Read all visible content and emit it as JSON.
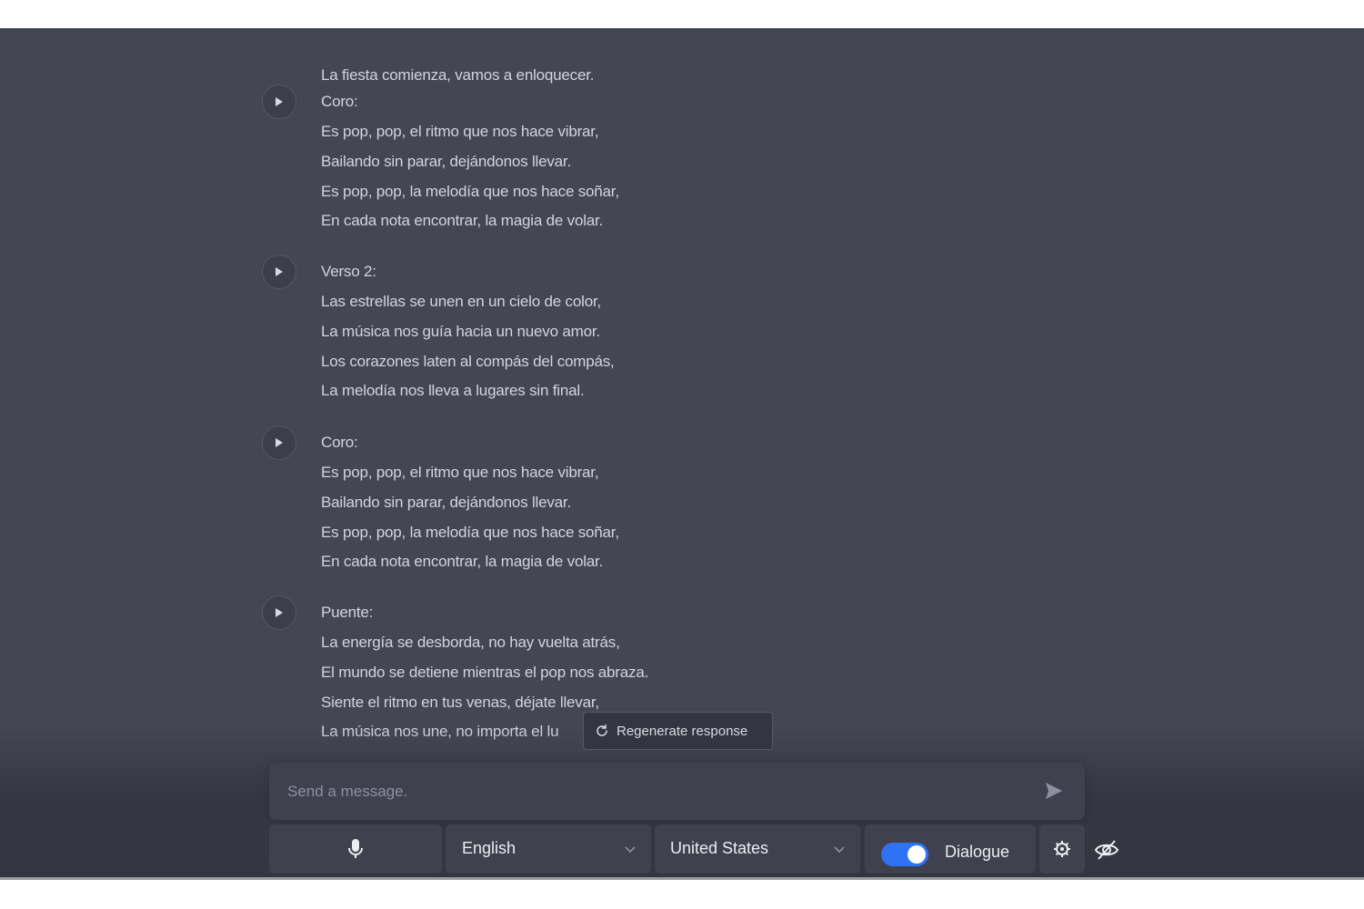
{
  "conversation": {
    "intro_line": "La fiesta comienza, vamos a enloquecer.",
    "stanzas": [
      {
        "heading": "Coro:",
        "lines": [
          "Es pop, pop, el ritmo que nos hace vibrar,",
          "Bailando sin parar, dejándonos llevar.",
          "Es pop, pop, la melodía que nos hace soñar,",
          "En cada nota encontrar, la magia de volar."
        ]
      },
      {
        "heading": "Verso 2:",
        "lines": [
          "Las estrellas se unen en un cielo de color,",
          "La música nos guía hacia un nuevo amor.",
          "Los corazones laten al compás del compás,",
          "La melodía nos lleva a lugares sin final."
        ]
      },
      {
        "heading": "Coro:",
        "lines": [
          "Es pop, pop, el ritmo que nos hace vibrar,",
          "Bailando sin parar, dejándonos llevar.",
          "Es pop, pop, la melodía que nos hace soñar,",
          "En cada nota encontrar, la magia de volar."
        ]
      },
      {
        "heading": "Puente:",
        "lines": [
          "La energía se desborda, no hay vuelta atrás,",
          "El mundo se detiene mientras el pop nos abraza.",
          "Siente el ritmo en tus venas, déjate llevar,",
          "La música nos une, no importa el lu"
        ]
      }
    ],
    "play_icon": "play-icon"
  },
  "regenerate": {
    "label": "Regenerate response",
    "icon": "refresh-icon"
  },
  "composer": {
    "placeholder": "Send a message.",
    "send_icon": "send-icon"
  },
  "toolbar": {
    "mic_icon": "microphone-icon",
    "language": "English",
    "country": "United States",
    "dialogue_label": "Dialogue",
    "dialogue_enabled": true,
    "settings_icon": "gear-icon",
    "visibility_icon": "eye-slash-icon"
  },
  "colors": {
    "background": "#444654",
    "panel": "#40414f",
    "text": "#d1d5db",
    "toggle_accent": "#2f72f6"
  }
}
